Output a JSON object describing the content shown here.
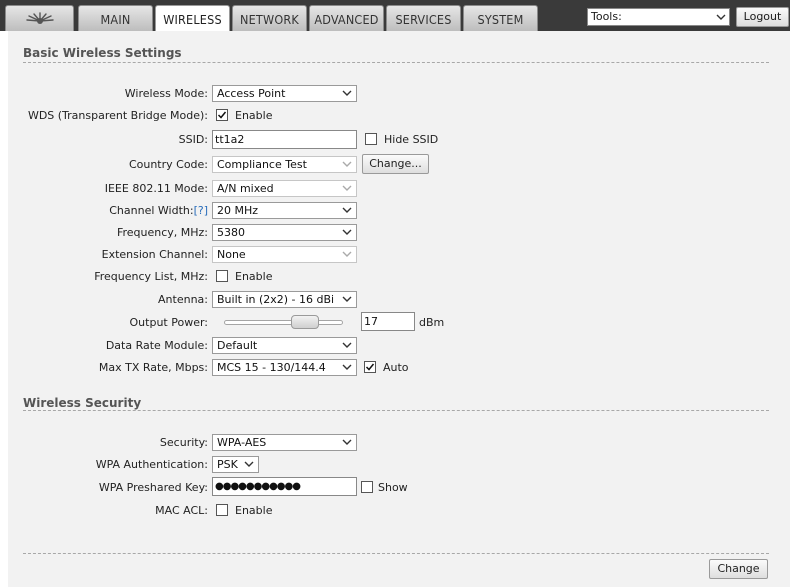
{
  "nav": {
    "tabs": [
      {
        "label": "MAIN"
      },
      {
        "label": "WIRELESS"
      },
      {
        "label": "NETWORK"
      },
      {
        "label": "ADVANCED"
      },
      {
        "label": "SERVICES"
      },
      {
        "label": "SYSTEM"
      }
    ],
    "active_tab": "WIRELESS",
    "tools_label": "Tools:",
    "logout_label": "Logout"
  },
  "basic": {
    "title": "Basic Wireless Settings",
    "wireless_mode": {
      "label": "Wireless Mode:",
      "value": "Access Point"
    },
    "wds": {
      "label": "WDS (Transparent Bridge Mode):",
      "checked": true,
      "option": "Enable"
    },
    "ssid": {
      "label": "SSID:",
      "value": "tt1a2",
      "hide_label": "Hide SSID",
      "hide_checked": false
    },
    "country_code": {
      "label": "Country Code:",
      "value": "Compliance Test",
      "change_label": "Change..."
    },
    "ieee_mode": {
      "label": "IEEE 802.11 Mode:",
      "value": "A/N mixed"
    },
    "channel_width": {
      "label": "Channel Width:",
      "help": "[?]",
      "value": "20 MHz"
    },
    "frequency": {
      "label": "Frequency, MHz:",
      "value": "5380"
    },
    "extension_channel": {
      "label": "Extension Channel:",
      "value": "None"
    },
    "frequency_list": {
      "label": "Frequency List, MHz:",
      "checked": false,
      "option": "Enable"
    },
    "antenna": {
      "label": "Antenna:",
      "value": "Built in (2x2) - 16 dBi"
    },
    "output_power": {
      "label": "Output Power:",
      "value": "17",
      "unit": "dBm"
    },
    "data_rate_module": {
      "label": "Data Rate Module:",
      "value": "Default"
    },
    "max_tx_rate": {
      "label": "Max TX Rate, Mbps:",
      "value": "MCS 15 - 130/144.4",
      "auto_label": "Auto",
      "auto_checked": true
    }
  },
  "security": {
    "title": "Wireless Security",
    "security": {
      "label": "Security:",
      "value": "WPA-AES"
    },
    "wpa_auth": {
      "label": "WPA Authentication:",
      "value": "PSK"
    },
    "psk": {
      "label": "WPA Preshared Key:",
      "value": "●●●●●●●●●●●",
      "show_label": "Show",
      "show_checked": false
    },
    "mac_acl": {
      "label": "MAC ACL:",
      "checked": false,
      "option": "Enable"
    }
  },
  "footer": {
    "change_label": "Change"
  }
}
